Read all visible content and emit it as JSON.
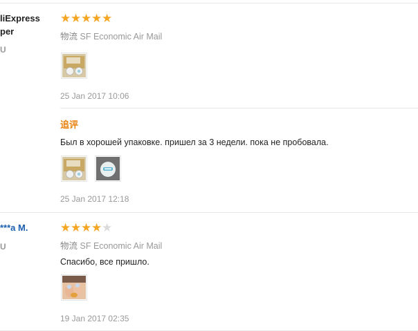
{
  "reviews": [
    {
      "user_name_lines": [
        "liExpress",
        "per"
      ],
      "country": "U",
      "rating": 5,
      "logistics_label": "物流",
      "logistics_value": "SF Economic Air Mail",
      "images": [
        "product-photo-1"
      ],
      "date": "25 Jan 2017 10:06",
      "followup": {
        "label": "追评",
        "text": "Был в хорошей упаковке. пришел за 3 недели. пока не пробовала.",
        "images": [
          "product-photo-2",
          "product-photo-3"
        ],
        "date": "25 Jan 2017 12:18"
      }
    },
    {
      "user_name_lines": [
        "***a M."
      ],
      "country": "U",
      "rating": 4,
      "logistics_label": "物流",
      "logistics_value": "SF Economic Air Mail",
      "text": "Спасибо, все пришло.",
      "images": [
        "product-photo-4"
      ],
      "date": "19 Jan 2017 02:35"
    }
  ],
  "colors": {
    "star_on": "#f5a623",
    "star_off": "#dadada",
    "followup_label": "#e8820c",
    "user_name_blue": "#1c5fb0"
  },
  "max_rating": 5
}
